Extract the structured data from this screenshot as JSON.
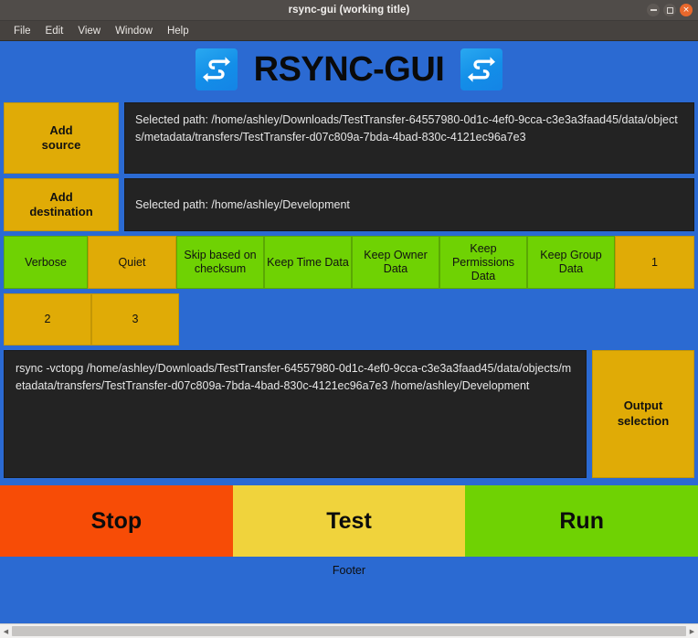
{
  "window": {
    "title": "rsync-gui (working title)",
    "controls": {
      "minimize": "minimize-icon",
      "maximize": "maximize-icon",
      "close": "×"
    }
  },
  "menubar": {
    "items": [
      "File",
      "Edit",
      "View",
      "Window",
      "Help"
    ]
  },
  "header": {
    "app_title": "RSYNC-GUI",
    "left_icon": "sync-arrows-icon",
    "right_icon": "sync-arrows-icon"
  },
  "source": {
    "button_line1": "Add",
    "button_line2": "source",
    "path_text": "Selected path: /home/ashley/Downloads/TestTransfer-64557980-0d1c-4ef0-9cca-c3e3a3faad45/data/objects/metadata/transfers/TestTransfer-d07c809a-7bda-4bad-830c-4121ec96a7e3"
  },
  "destination": {
    "button_line1": "Add",
    "button_line2": "destination",
    "path_text": "Selected path: /home/ashley/Development"
  },
  "options": [
    {
      "label": "Verbose",
      "state": "on"
    },
    {
      "label": "Quiet",
      "state": "off"
    },
    {
      "label": "Skip based on checksum",
      "state": "on"
    },
    {
      "label": "Keep Time Data",
      "state": "on"
    },
    {
      "label": "Keep Owner Data",
      "state": "on"
    },
    {
      "label": "Keep Permissions Data",
      "state": "on"
    },
    {
      "label": "Keep Group Data",
      "state": "on"
    },
    {
      "label": "1",
      "state": "off"
    },
    {
      "label": "2",
      "state": "off"
    },
    {
      "label": "3",
      "state": "off"
    }
  ],
  "command": {
    "text": "rsync -vctopg /home/ashley/Downloads/TestTransfer-64557980-0d1c-4ef0-9cca-c3e3a3faad45/data/objects/metadata/transfers/TestTransfer-d07c809a-7bda-4bad-830c-4121ec96a7e3 /home/ashley/Development"
  },
  "output_selection": {
    "line1": "Output",
    "line2": "selection"
  },
  "actions": {
    "stop": "Stop",
    "test": "Test",
    "run": "Run"
  },
  "footer": {
    "text": "Footer"
  },
  "colors": {
    "canvas_blue": "#2b6ad2",
    "gold": "#e0ab06",
    "green": "#6fd203",
    "stop_orange": "#f74c06",
    "test_yellow": "#f0d33c",
    "dark_panel": "#232323",
    "titlebar": "#504c49",
    "menubar": "#46423f"
  }
}
